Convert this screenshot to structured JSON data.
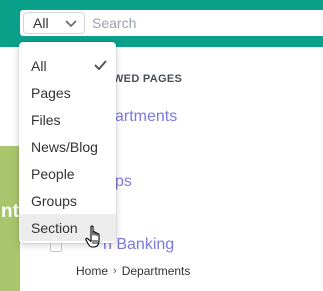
{
  "search": {
    "scope_value": "All",
    "placeholder": "Search"
  },
  "dropdown": {
    "options": [
      "All",
      "Pages",
      "Files",
      "News/Blog",
      "People",
      "Groups",
      "Section"
    ],
    "selected": "All",
    "hovered": "Section"
  },
  "background": {
    "recent_heading": "WED PAGES",
    "recent_links": [
      "artments",
      "ps",
      "h Banking"
    ],
    "left_panel_text": "nt",
    "breadcrumb": {
      "home": "Home",
      "current": "Departments"
    }
  },
  "colors": {
    "top_bar": "#0aa08a",
    "link": "#7b78e0",
    "left_panel": "#a9c66c",
    "hover": "#ececec"
  },
  "icons": {
    "scope_chevron": "chevron-down-icon",
    "selected_check": "checkmark-icon",
    "cursor": "hand-pointer-icon",
    "breadcrumb_separator": "chevron-right-icon"
  }
}
